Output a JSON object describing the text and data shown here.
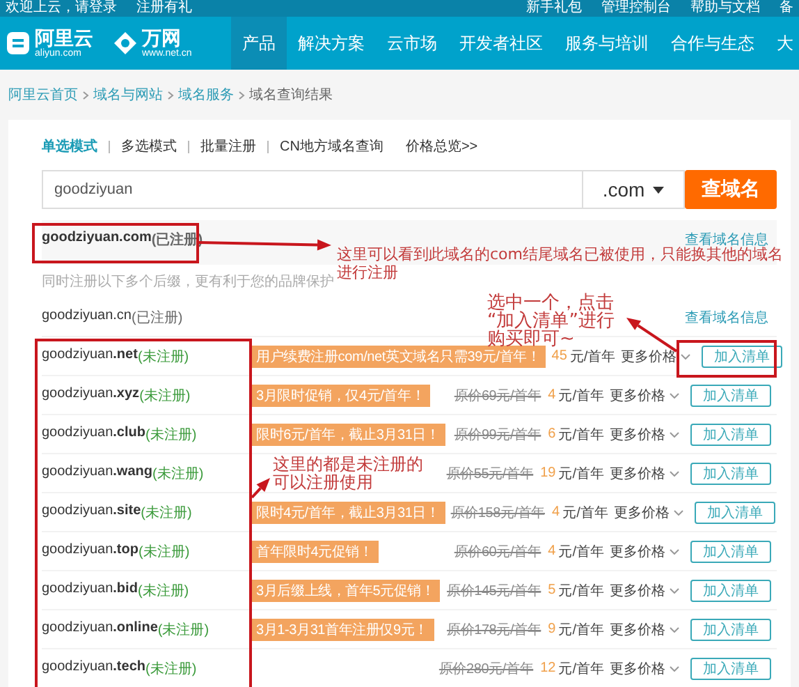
{
  "top_bar": {
    "left_links": [
      "欢迎上云，请登录",
      "注册有礼"
    ],
    "right_links": [
      "新手礼包",
      "管理控制台",
      "帮助与文档",
      "备"
    ]
  },
  "header": {
    "logos": [
      {
        "kind": "aliyun",
        "name": "阿里云",
        "sub": "aliyun.com"
      },
      {
        "kind": "wanwang",
        "name": "万网",
        "sub": "www.net.cn"
      }
    ],
    "nav": [
      {
        "label": "产品",
        "selected": true
      },
      {
        "label": "解决方案",
        "selected": false
      },
      {
        "label": "云市场",
        "selected": false
      },
      {
        "label": "开发者社区",
        "selected": false
      },
      {
        "label": "服务与培训",
        "selected": false
      },
      {
        "label": "合作与生态",
        "selected": false
      },
      {
        "label": "大",
        "selected": false
      }
    ]
  },
  "breadcrumb": [
    "阿里云首页",
    "域名与网站",
    "域名服务",
    "域名查询结果"
  ],
  "search_modes": [
    {
      "label": "单选模式",
      "selected": true
    },
    {
      "label": "多选模式",
      "selected": false
    },
    {
      "label": "批量注册",
      "selected": false
    },
    {
      "label": "CN地方域名查询",
      "selected": false
    },
    {
      "label": "价格总览>>",
      "selected": false
    }
  ],
  "search": {
    "value": "goodziyuan",
    "suffix": ".com",
    "button": "查域名"
  },
  "results": [
    {
      "kind": "main",
      "domain": "goodziyuan.com",
      "status": "(已注册)",
      "registered": true,
      "link": "查看域名信息"
    },
    {
      "kind": "note",
      "text": "同时注册以下多个后缀，更有利于您的品牌保护"
    },
    {
      "kind": "other",
      "domain": "goodziyuan.cn",
      "status": "(已注册)",
      "registered": true,
      "link": "查看域名信息"
    },
    {
      "kind": "other",
      "domain": "goodziyuan**.net**",
      "status": "(未注册)",
      "registered": false,
      "promo": "用户续费注册com/net英文域名只需39元/首年！",
      "price": "45",
      "unit": "元/首年",
      "more": "更多价格",
      "button": "加入清单"
    },
    {
      "kind": "other",
      "domain": "goodziyuan**.xyz**",
      "status": "(未注册)",
      "registered": false,
      "promo": "3月限时促销，仅4元/首年！",
      "original_price": "原价69元/首年",
      "price": "4",
      "unit": "元/首年",
      "more": "更多价格",
      "button": "加入清单"
    },
    {
      "kind": "other",
      "domain": "goodziyuan**.club**",
      "status": "(未注册)",
      "registered": false,
      "promo": "限时6元/首年，截止3月31日！",
      "original_price": "原价99元/首年",
      "price": "6",
      "unit": "元/首年",
      "more": "更多价格",
      "button": "加入清单"
    },
    {
      "kind": "other",
      "domain": "goodziyuan**.wang**",
      "status": "(未注册)",
      "registered": false,
      "original_price": "原价55元/首年",
      "price": "19",
      "unit": "元/首年",
      "more": "更多价格",
      "button": "加入清单"
    },
    {
      "kind": "other",
      "domain": "goodziyuan**.site**",
      "status": "(未注册)",
      "registered": false,
      "promo": "限时4元/首年，截止3月31日！",
      "original_price": "原价158元/首年",
      "price": "4",
      "unit": "元/首年",
      "more": "更多价格",
      "button": "加入清单"
    },
    {
      "kind": "other",
      "domain": "goodziyuan**.top**",
      "status": "(未注册)",
      "registered": false,
      "promo": "首年限时4元促销！",
      "original_price": "原价60元/首年",
      "price": "4",
      "unit": "元/首年",
      "more": "更多价格",
      "button": "加入清单"
    },
    {
      "kind": "other",
      "domain": "goodziyuan**.bid**",
      "status": "(未注册)",
      "registered": false,
      "promo": "3月后缀上线，首年5元促销！",
      "original_price": "原价145元/首年",
      "price": "5",
      "unit": "元/首年",
      "more": "更多价格",
      "button": "加入清单"
    },
    {
      "kind": "other",
      "domain": "goodziyuan**.online**",
      "status": "(未注册)",
      "registered": false,
      "promo": "3月1-3月31首年注册仅9元！",
      "original_price": "原价178元/首年",
      "price": "9",
      "unit": "元/首年",
      "more": "更多价格",
      "button": "加入清单"
    },
    {
      "kind": "other",
      "domain": "goodziyuan**.tech**",
      "status": "(未注册)",
      "registered": false,
      "original_price": "原价280元/首年",
      "price": "12",
      "unit": "元/首年",
      "more": "更多价格",
      "button": "加入清单"
    }
  ],
  "annotations": [
    {
      "lines": [
        "这里可以看到此域名的com结尾域名已被使用，只能换其他的域名",
        "进行注册"
      ]
    },
    {
      "lines": [
        "选中一个，点击",
        "“加入清单”进行",
        "购买即可~"
      ]
    },
    {
      "lines": [
        "这里的都是未注册的",
        "可以注册使用"
      ]
    }
  ]
}
